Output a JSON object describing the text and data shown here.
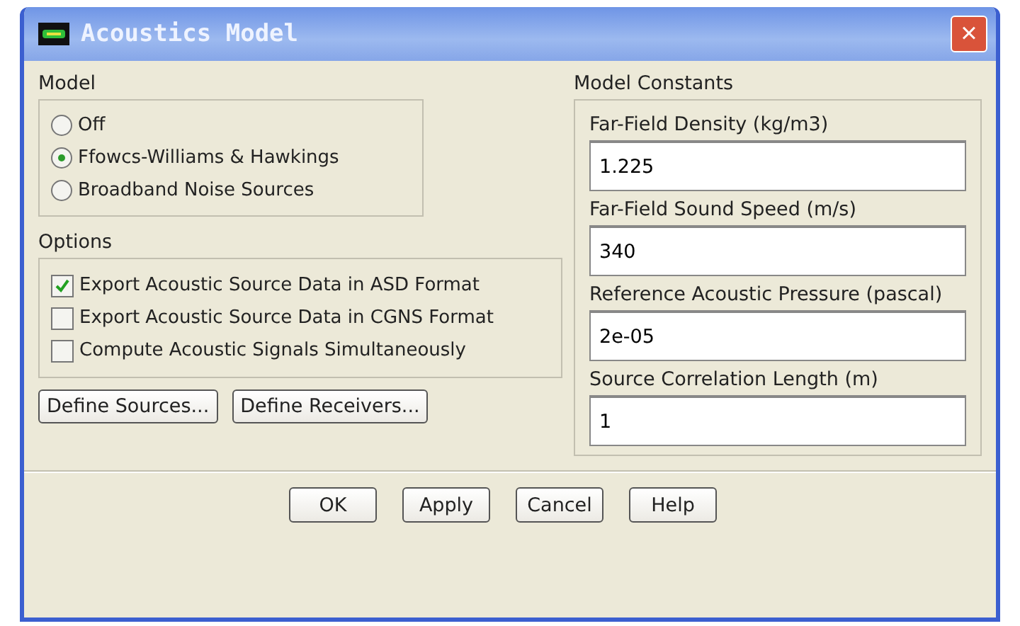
{
  "window": {
    "title": "Acoustics Model",
    "close": "×"
  },
  "model": {
    "label": "Model",
    "options": [
      {
        "label": "Off",
        "selected": false
      },
      {
        "label": "Ffowcs-Williams & Hawkings",
        "selected": true
      },
      {
        "label": "Broadband Noise Sources",
        "selected": false
      }
    ]
  },
  "options": {
    "label": "Options",
    "items": [
      {
        "label": "Export Acoustic Source Data in ASD Format",
        "checked": true
      },
      {
        "label": "Export Acoustic Source Data in CGNS Format",
        "checked": false
      },
      {
        "label": "Compute Acoustic Signals Simultaneously",
        "checked": false
      }
    ]
  },
  "define_buttons": [
    "Define Sources...",
    "Define Receivers..."
  ],
  "constants": {
    "label": "Model Constants",
    "fields": [
      {
        "label": "Far-Field Density (kg/m3)",
        "value": "1.225"
      },
      {
        "label": "Far-Field Sound Speed (m/s)",
        "value": "340"
      },
      {
        "label": "Reference Acoustic Pressure (pascal)",
        "value": "2e-05"
      },
      {
        "label": "Source Correlation Length (m)",
        "value": "1"
      }
    ]
  },
  "buttons": [
    "OK",
    "Apply",
    "Cancel",
    "Help"
  ]
}
